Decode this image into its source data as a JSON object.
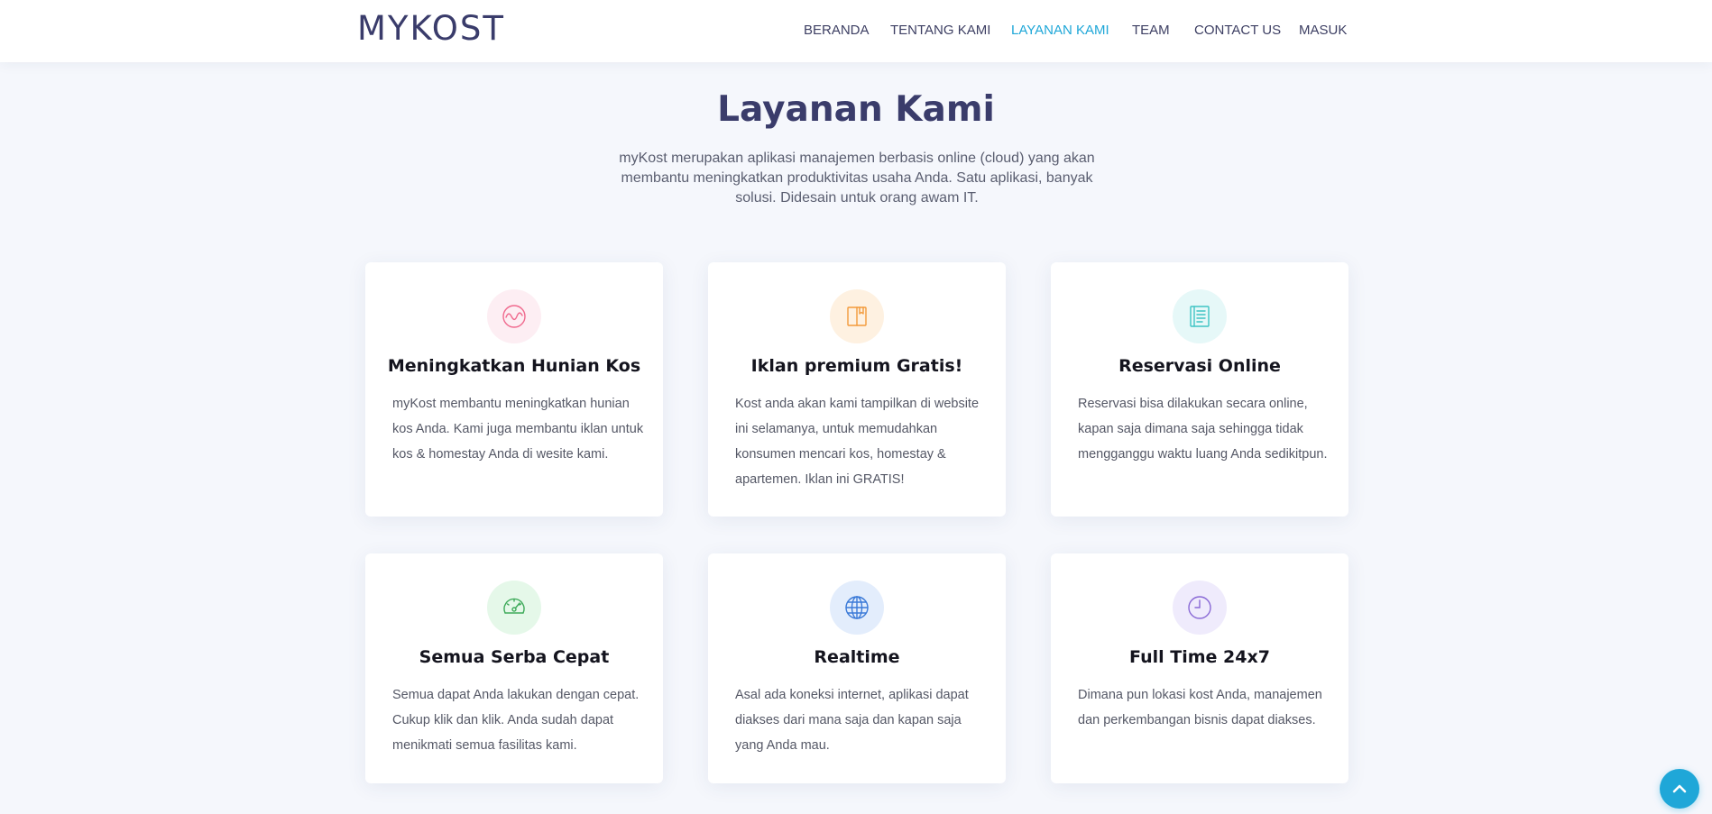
{
  "header": {
    "logo": "MYKOST",
    "nav": [
      {
        "label": "BERANDA",
        "active": false
      },
      {
        "label": "TENTANG KAMI",
        "active": false
      },
      {
        "label": "LAYANAN KAMI",
        "active": true
      },
      {
        "label": "TEAM",
        "active": false
      },
      {
        "label": "CONTACT US",
        "active": false
      },
      {
        "label": "MASUK",
        "active": false
      }
    ]
  },
  "section": {
    "title": "Layanan Kami",
    "description": "myKost merupakan aplikasi manajemen berbasis online (cloud) yang akan membantu meningkatkan produktivitas usaha Anda. Satu aplikasi, banyak solusi. Didesain untuk orang awam IT."
  },
  "services": [
    {
      "icon": "pulse-icon",
      "icon_color": "#f06a8e",
      "icon_bg": "#fdeef3",
      "title": "Meningkatkan Hunian Kos",
      "text": "myKost membantu meningkatkan hunian kos Anda. Kami juga membantu iklan untuk kos & homestay Anda di wesite kami."
    },
    {
      "icon": "book-icon",
      "icon_color": "#f39a3b",
      "icon_bg": "#fef1e1",
      "title": "Iklan premium Gratis!",
      "text": "Kost anda akan kami tampilkan di website ini selamanya, untuk memudahkan konsumen mencari kos, homestay & apartemen. Iklan ini GRATIS!"
    },
    {
      "icon": "document-icon",
      "icon_color": "#3fc4c4",
      "icon_bg": "#e6f8f8",
      "title": "Reservasi Online",
      "text": "Reservasi bisa dilakukan secara online, kapan saja dimana saja sehingga tidak mengganggu waktu luang Anda sedikitpun."
    },
    {
      "icon": "speedometer-icon",
      "icon_color": "#3eaa5a",
      "icon_bg": "#e5f8e9",
      "title": "Semua Serba Cepat",
      "text": "Semua dapat Anda lakukan dengan cepat. Cukup klik dan klik. Anda sudah dapat menikmati semua fasilitas kami."
    },
    {
      "icon": "globe-icon",
      "icon_color": "#3b7ad8",
      "icon_bg": "#e3edfc",
      "title": "Realtime",
      "text": "Asal ada koneksi internet, aplikasi dapat diakses dari mana saja dan kapan saja yang Anda mau."
    },
    {
      "icon": "clock-icon",
      "icon_color": "#8a6ad6",
      "icon_bg": "#efebfc",
      "title": "Full Time 24x7",
      "text": "Dimana pun lokasi kost Anda, manajemen dan perkembangan bisnis dapat diakses."
    }
  ],
  "back_to_top": {
    "icon": "chevron-up-icon",
    "color": "#1fa7d8"
  }
}
